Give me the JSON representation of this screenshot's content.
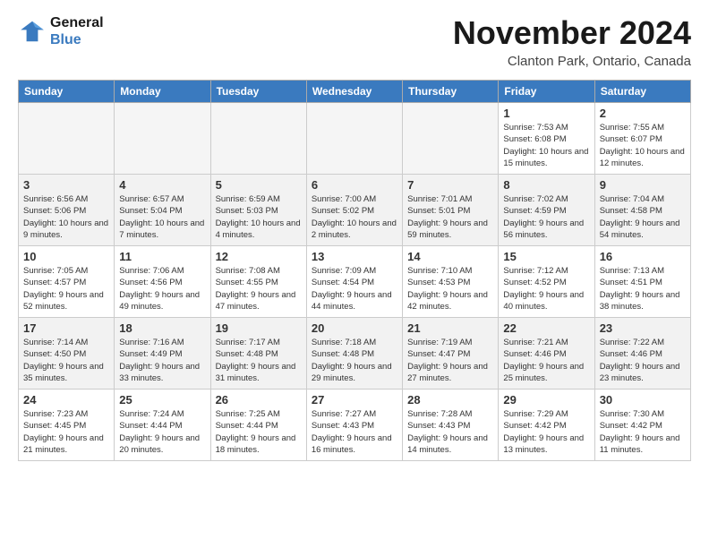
{
  "header": {
    "logo_line1": "General",
    "logo_line2": "Blue",
    "month": "November 2024",
    "location": "Clanton Park, Ontario, Canada"
  },
  "weekdays": [
    "Sunday",
    "Monday",
    "Tuesday",
    "Wednesday",
    "Thursday",
    "Friday",
    "Saturday"
  ],
  "weeks": [
    [
      {
        "day": "",
        "info": ""
      },
      {
        "day": "",
        "info": ""
      },
      {
        "day": "",
        "info": ""
      },
      {
        "day": "",
        "info": ""
      },
      {
        "day": "",
        "info": ""
      },
      {
        "day": "1",
        "info": "Sunrise: 7:53 AM\nSunset: 6:08 PM\nDaylight: 10 hours and 15 minutes."
      },
      {
        "day": "2",
        "info": "Sunrise: 7:55 AM\nSunset: 6:07 PM\nDaylight: 10 hours and 12 minutes."
      }
    ],
    [
      {
        "day": "3",
        "info": "Sunrise: 6:56 AM\nSunset: 5:06 PM\nDaylight: 10 hours and 9 minutes."
      },
      {
        "day": "4",
        "info": "Sunrise: 6:57 AM\nSunset: 5:04 PM\nDaylight: 10 hours and 7 minutes."
      },
      {
        "day": "5",
        "info": "Sunrise: 6:59 AM\nSunset: 5:03 PM\nDaylight: 10 hours and 4 minutes."
      },
      {
        "day": "6",
        "info": "Sunrise: 7:00 AM\nSunset: 5:02 PM\nDaylight: 10 hours and 2 minutes."
      },
      {
        "day": "7",
        "info": "Sunrise: 7:01 AM\nSunset: 5:01 PM\nDaylight: 9 hours and 59 minutes."
      },
      {
        "day": "8",
        "info": "Sunrise: 7:02 AM\nSunset: 4:59 PM\nDaylight: 9 hours and 56 minutes."
      },
      {
        "day": "9",
        "info": "Sunrise: 7:04 AM\nSunset: 4:58 PM\nDaylight: 9 hours and 54 minutes."
      }
    ],
    [
      {
        "day": "10",
        "info": "Sunrise: 7:05 AM\nSunset: 4:57 PM\nDaylight: 9 hours and 52 minutes."
      },
      {
        "day": "11",
        "info": "Sunrise: 7:06 AM\nSunset: 4:56 PM\nDaylight: 9 hours and 49 minutes."
      },
      {
        "day": "12",
        "info": "Sunrise: 7:08 AM\nSunset: 4:55 PM\nDaylight: 9 hours and 47 minutes."
      },
      {
        "day": "13",
        "info": "Sunrise: 7:09 AM\nSunset: 4:54 PM\nDaylight: 9 hours and 44 minutes."
      },
      {
        "day": "14",
        "info": "Sunrise: 7:10 AM\nSunset: 4:53 PM\nDaylight: 9 hours and 42 minutes."
      },
      {
        "day": "15",
        "info": "Sunrise: 7:12 AM\nSunset: 4:52 PM\nDaylight: 9 hours and 40 minutes."
      },
      {
        "day": "16",
        "info": "Sunrise: 7:13 AM\nSunset: 4:51 PM\nDaylight: 9 hours and 38 minutes."
      }
    ],
    [
      {
        "day": "17",
        "info": "Sunrise: 7:14 AM\nSunset: 4:50 PM\nDaylight: 9 hours and 35 minutes."
      },
      {
        "day": "18",
        "info": "Sunrise: 7:16 AM\nSunset: 4:49 PM\nDaylight: 9 hours and 33 minutes."
      },
      {
        "day": "19",
        "info": "Sunrise: 7:17 AM\nSunset: 4:48 PM\nDaylight: 9 hours and 31 minutes."
      },
      {
        "day": "20",
        "info": "Sunrise: 7:18 AM\nSunset: 4:48 PM\nDaylight: 9 hours and 29 minutes."
      },
      {
        "day": "21",
        "info": "Sunrise: 7:19 AM\nSunset: 4:47 PM\nDaylight: 9 hours and 27 minutes."
      },
      {
        "day": "22",
        "info": "Sunrise: 7:21 AM\nSunset: 4:46 PM\nDaylight: 9 hours and 25 minutes."
      },
      {
        "day": "23",
        "info": "Sunrise: 7:22 AM\nSunset: 4:46 PM\nDaylight: 9 hours and 23 minutes."
      }
    ],
    [
      {
        "day": "24",
        "info": "Sunrise: 7:23 AM\nSunset: 4:45 PM\nDaylight: 9 hours and 21 minutes."
      },
      {
        "day": "25",
        "info": "Sunrise: 7:24 AM\nSunset: 4:44 PM\nDaylight: 9 hours and 20 minutes."
      },
      {
        "day": "26",
        "info": "Sunrise: 7:25 AM\nSunset: 4:44 PM\nDaylight: 9 hours and 18 minutes."
      },
      {
        "day": "27",
        "info": "Sunrise: 7:27 AM\nSunset: 4:43 PM\nDaylight: 9 hours and 16 minutes."
      },
      {
        "day": "28",
        "info": "Sunrise: 7:28 AM\nSunset: 4:43 PM\nDaylight: 9 hours and 14 minutes."
      },
      {
        "day": "29",
        "info": "Sunrise: 7:29 AM\nSunset: 4:42 PM\nDaylight: 9 hours and 13 minutes."
      },
      {
        "day": "30",
        "info": "Sunrise: 7:30 AM\nSunset: 4:42 PM\nDaylight: 9 hours and 11 minutes."
      }
    ]
  ]
}
